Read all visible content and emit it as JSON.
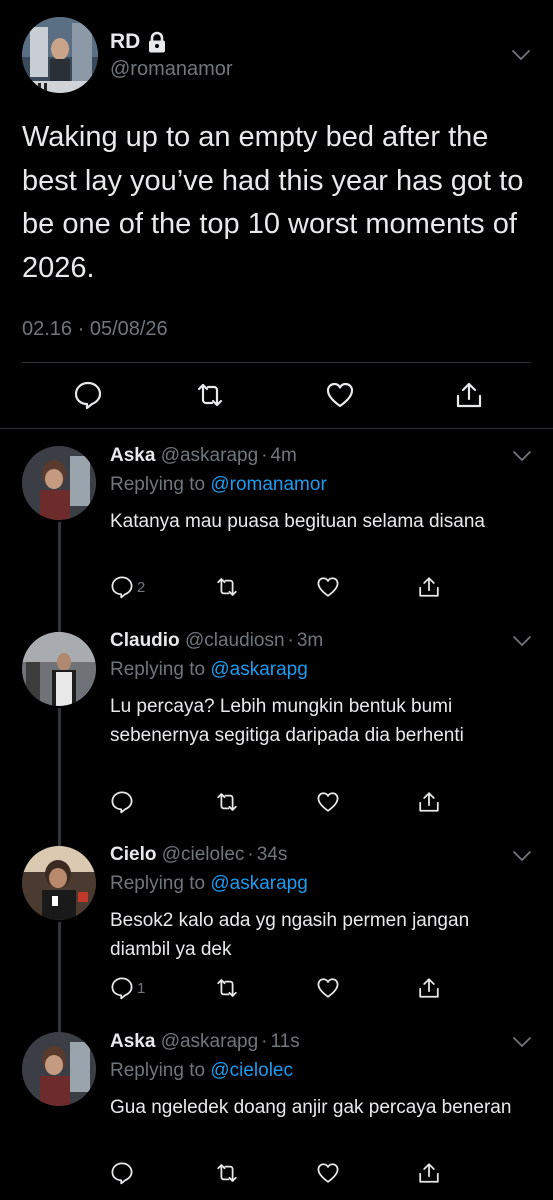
{
  "main_tweet": {
    "display_name": "RD",
    "handle": "@romanamor",
    "text": "Waking up to an empty bed after the best lay you’ve had this year has got to be one of the top 10 worst moments of 2026.",
    "meta": "02.16 · 05/08/26",
    "icons": {
      "lock": "lock-icon",
      "menu": "chevron-down-icon",
      "reply": "reply-icon",
      "retweet": "retweet-icon",
      "like": "heart-icon",
      "share": "share-icon"
    }
  },
  "replies": [
    {
      "display_name": "Aska",
      "handle": "@askarapg",
      "time": "4m",
      "replying_prefix": "Replying to ",
      "replying_to": "@romanamor",
      "text": "Katanya mau puasa begituan selama disana",
      "reply_count": "2"
    },
    {
      "display_name": "Claudio",
      "handle": "@claudiosn",
      "time": "3m",
      "replying_prefix": "Replying to ",
      "replying_to": "@askarapg",
      "text": "Lu percaya? Lebih mungkin bentuk bumi sebenernya segitiga daripada dia berhenti",
      "reply_count": ""
    },
    {
      "display_name": "Cielo",
      "handle": "@cielolec",
      "time": "34s",
      "replying_prefix": "Replying to ",
      "replying_to": "@askarapg",
      "text": "Besok2 kalo ada yg ngasih permen jangan diambil ya dek",
      "reply_count": "1"
    },
    {
      "display_name": "Aska",
      "handle": "@askarapg",
      "time": "11s",
      "replying_prefix": "Replying to ",
      "replying_to": "@cielolec",
      "text": "Gua ngeledek doang anjir gak percaya beneran",
      "reply_count": ""
    }
  ],
  "separator": "·",
  "colors": {
    "background": "#000000",
    "text": "#e7e9ea",
    "muted": "#71767b",
    "link": "#1d9bf0",
    "divider": "#2f3336"
  }
}
